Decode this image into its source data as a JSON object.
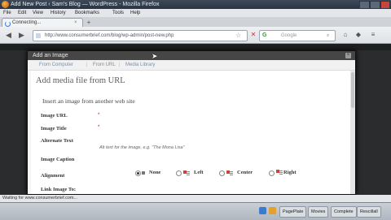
{
  "window": {
    "title": "Add New Post ‹ Sam's Blog — WordPress - Mozilla Firefox"
  },
  "menu": [
    "File",
    "Edit",
    "View",
    "History",
    "Bookmarks",
    "Tools",
    "Help"
  ],
  "tab": {
    "label": "Connecting...",
    "close": "×"
  },
  "newtab_label": "+",
  "nav": {
    "back": "◀",
    "forward": "▶",
    "url": "http://www.consumerbrief.com/blog/wp-admin/post-new.php",
    "bookmark_star": "☆",
    "search_engine": "Google",
    "search_placeholder": "Google",
    "search_glass": "⌕",
    "icons": [
      "home-icon",
      "addon-icon",
      "menu-icon"
    ]
  },
  "modal": {
    "title": "Add an Image",
    "close": "×",
    "tabs": [
      {
        "label": "From Computer",
        "active": false
      },
      {
        "label": "From URL",
        "active": true
      },
      {
        "label": "Media Library",
        "active": false
      }
    ],
    "heading": "Add media file from URL",
    "subheading": "Insert an image from another web site",
    "fields": [
      {
        "label": "Image URL",
        "required": "*"
      },
      {
        "label": "Image Title",
        "required": "*"
      },
      {
        "label": "Alternate Text",
        "required": ""
      },
      {
        "label": "Image Caption",
        "required": ""
      },
      {
        "label": "Alignment",
        "required": ""
      },
      {
        "label": "Link Image To:",
        "required": ""
      }
    ],
    "alt_hint": "Alt text for the image, e.g. \"The Mona Lisa\"",
    "alignment_options": [
      {
        "label": "None",
        "selected": true
      },
      {
        "label": "Left",
        "selected": false
      },
      {
        "label": "Center",
        "selected": false
      },
      {
        "label": "Right",
        "selected": false
      }
    ]
  },
  "status": "Waiting for www.consumerbrief.com...",
  "taskbar": {
    "items": [
      "PagePlate",
      "Movies",
      "Complete",
      "Rescillall"
    ]
  }
}
